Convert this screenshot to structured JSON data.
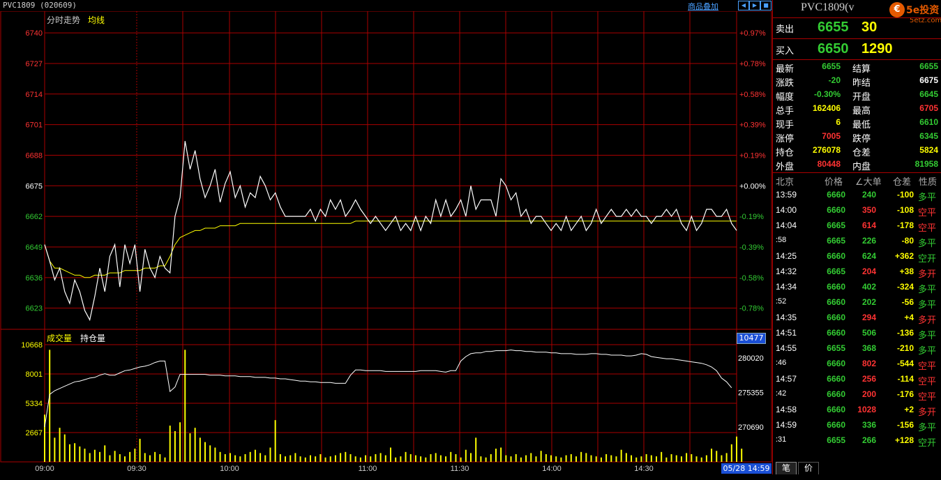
{
  "header": {
    "symbol": "PVC1809 (020609)",
    "overlay_link": "商品叠加",
    "toolbar_icons": [
      "prev-icon",
      "next-icon",
      "zoom-icon",
      "maximize-icon"
    ]
  },
  "intraday": {
    "title": "分时走势",
    "avg_label": "均线",
    "price_ticks": [
      "6740",
      "6727",
      "6714",
      "6701",
      "6688",
      "6675",
      "6662",
      "6649",
      "6636",
      "6623"
    ],
    "pct_ticks": [
      "+0.97%",
      "+0.78%",
      "+0.58%",
      "+0.39%",
      "+0.19%",
      "+0.00%",
      "-0.19%",
      "-0.39%",
      "-0.58%",
      "-0.78%"
    ]
  },
  "volume": {
    "title": "成交量",
    "oi_label": "持仓量",
    "left_ticks": [
      "10668",
      "8001",
      "5334",
      "2667"
    ],
    "right_ticks": [
      "280020",
      "275355",
      "270690"
    ],
    "highlight": "10477"
  },
  "time_axis": [
    "09:00",
    "09:30",
    "10:00",
    "11:00",
    "11:30",
    "14:00",
    "14:30"
  ],
  "date_box": "05/28 14:59",
  "chart_data": {
    "type": "line",
    "title": "分时走势",
    "series": [
      {
        "name": "分时走势",
        "values": [
          6650,
          6643,
          6635,
          6640,
          6630,
          6625,
          6635,
          6630,
          6622,
          6618,
          6628,
          6640,
          6630,
          6645,
          6650,
          6632,
          6650,
          6642,
          6650,
          6630,
          6648,
          6640,
          6636,
          6645,
          6640,
          6638,
          6662,
          6670,
          6694,
          6682,
          6690,
          6678,
          6670,
          6675,
          6682,
          6668,
          6676,
          6681,
          6670,
          6675,
          6666,
          6672,
          6670,
          6679,
          6675,
          6669,
          6672,
          6666,
          6662,
          6662,
          6662,
          6662,
          6662,
          6665,
          6660,
          6665,
          6662,
          6669,
          6665,
          6669,
          6662,
          6665,
          6669,
          6665,
          6662,
          6659,
          6662,
          6659,
          6656,
          6659,
          6662,
          6656,
          6659,
          6656,
          6662,
          6656,
          6662,
          6659,
          6669,
          6662,
          6669,
          6662,
          6665,
          6669,
          6662,
          6675,
          6665,
          6669,
          6669,
          6669,
          6662,
          6678,
          6675,
          6669,
          6672,
          6662,
          6665,
          6659,
          6662,
          6662,
          6659,
          6656,
          6659,
          6656,
          6662,
          6656,
          6659,
          6662,
          6656,
          6659,
          6665,
          6659,
          6662,
          6665,
          6662,
          6662,
          6665,
          6662,
          6665,
          6662,
          6662,
          6659,
          6662,
          6662,
          6665,
          6662,
          6665,
          6659,
          6656,
          6662,
          6656,
          6659,
          6665,
          6665,
          6662,
          6662,
          6665,
          6659,
          6656
        ]
      },
      {
        "name": "均线",
        "values": [
          6650,
          6643,
          6640,
          6640,
          6639,
          6638,
          6637,
          6637,
          6636,
          6636,
          6637,
          6637,
          6637,
          6638,
          6638,
          6638,
          6639,
          6639,
          6639,
          6639,
          6640,
          6640,
          6640,
          6641,
          6641,
          6645,
          6650,
          6653,
          6654,
          6655,
          6656,
          6656,
          6657,
          6657,
          6657,
          6658,
          6658,
          6658,
          6658,
          6659,
          6659,
          6659,
          6659,
          6659,
          6659,
          6659,
          6659,
          6659,
          6659,
          6659,
          6659,
          6659,
          6659,
          6659,
          6659,
          6659,
          6659,
          6659,
          6659,
          6659,
          6659,
          6659,
          6660,
          6660,
          6660,
          6660,
          6660,
          6660,
          6660,
          6660,
          6660,
          6660,
          6660,
          6660,
          6660,
          6660,
          6660,
          6660,
          6660,
          6660,
          6660,
          6660,
          6660,
          6660,
          6660,
          6660,
          6660,
          6660,
          6660,
          6660,
          6660,
          6660,
          6660,
          6660,
          6660,
          6660,
          6660,
          6660,
          6660,
          6660,
          6660,
          6660,
          6660,
          6660,
          6660,
          6660,
          6660,
          6660,
          6660,
          6660,
          6660,
          6660,
          6660,
          6660,
          6660,
          6660,
          6660,
          6660,
          6660,
          6660,
          6660,
          6660,
          6660,
          6660,
          6660,
          6660,
          6660,
          6660,
          6660,
          6660,
          6660,
          6660,
          6660,
          6660,
          6660,
          6660,
          6660,
          6660,
          6660
        ]
      },
      {
        "name": "成交量",
        "values": [
          4300,
          10200,
          2200,
          3100,
          2500,
          1600,
          1700,
          1400,
          1200,
          800,
          1100,
          900,
          1500,
          600,
          1000,
          700,
          500,
          900,
          1200,
          2100,
          800,
          600,
          900,
          700,
          400,
          3300,
          2800,
          3600,
          10200,
          2600,
          3100,
          2200,
          1800,
          1500,
          1300,
          900,
          700,
          800,
          600,
          500,
          700,
          900,
          1100,
          800,
          600,
          1300,
          3800,
          700,
          500,
          600,
          800,
          500,
          400,
          600,
          500,
          700,
          400,
          500,
          600,
          800,
          900,
          700,
          500,
          400,
          600,
          500,
          700,
          800,
          600,
          1300,
          400,
          500,
          900,
          700,
          600,
          500,
          400,
          700,
          800,
          600,
          500,
          900,
          700,
          400,
          1100,
          800,
          2200,
          500,
          400,
          700,
          1200,
          1300,
          600,
          500,
          700,
          400,
          600,
          800,
          500,
          1000,
          700,
          600,
          500,
          400,
          600,
          700,
          500,
          900,
          800,
          600,
          500,
          400,
          700,
          600,
          500,
          1100,
          800,
          600,
          400,
          500,
          700,
          600,
          500,
          900,
          400,
          700,
          600,
          500,
          800,
          700,
          500,
          400,
          600,
          1200,
          1000,
          600,
          800,
          1600,
          2300,
          1200
        ]
      },
      {
        "name": "持仓量",
        "values": [
          270700,
          275100,
          275600,
          275900,
          276200,
          276500,
          276800,
          276900,
          277100,
          277300,
          277400,
          277700,
          277900,
          277700,
          277700,
          278000,
          278300,
          278400,
          278600,
          278800,
          278900,
          279100,
          279400,
          279600,
          279600,
          275500,
          276100,
          277800,
          277800,
          277800,
          277800,
          277800,
          277800,
          277700,
          277700,
          277700,
          277600,
          277600,
          277600,
          277500,
          277500,
          277500,
          277400,
          277400,
          277400,
          277300,
          277300,
          277200,
          277200,
          277100,
          277000,
          276900,
          276900,
          276800,
          276800,
          276700,
          276700,
          276700,
          276600,
          276600,
          276600,
          277700,
          278400,
          278400,
          278300,
          278300,
          278300,
          278300,
          278200,
          278200,
          278200,
          278200,
          278200,
          278200,
          278200,
          278300,
          278300,
          278300,
          278300,
          278200,
          278100,
          278300,
          278300,
          279600,
          280200,
          280600,
          280700,
          280700,
          280900,
          280900,
          281000,
          281000,
          281000,
          281100,
          281000,
          281000,
          280900,
          280900,
          280800,
          280800,
          280800,
          280700,
          280700,
          280600,
          280600,
          280600,
          280500,
          280500,
          280500,
          280600,
          280600,
          280500,
          280500,
          280400,
          280400,
          280400,
          280300,
          280300,
          280400,
          280600,
          280500,
          280200,
          280100,
          280000,
          279900,
          279900,
          279800,
          279700,
          279600,
          279500,
          279400,
          279300,
          279100,
          278800,
          278300,
          277300,
          276800,
          276000
        ]
      }
    ],
    "price_ylim": [
      6614,
      6743
    ],
    "volume_ylim": [
      0,
      10668
    ],
    "oi_ylim": [
      266000,
      282000
    ]
  },
  "side": {
    "title": "PVC1809(v",
    "logo_text": "5e投资",
    "logo_url": "5etz.com",
    "ask_label": "卖出",
    "ask_price": "6655",
    "ask_vol": "30",
    "bid_label": "买入",
    "bid_price": "6650",
    "bid_vol": "1290",
    "stats": [
      {
        "l1": "最新",
        "v1": "6655",
        "c1": "#3c3",
        "l2": "结算",
        "v2": "6655",
        "c2": "#3c3"
      },
      {
        "l1": "涨跌",
        "v1": "-20",
        "c1": "#3c3",
        "l2": "昨结",
        "v2": "6675",
        "c2": "#fff"
      },
      {
        "l1": "幅度",
        "v1": "-0.30%",
        "c1": "#3c3",
        "l2": "开盘",
        "v2": "6645",
        "c2": "#3c3"
      },
      {
        "l1": "总手",
        "v1": "162406",
        "c1": "#ff0",
        "l2": "最高",
        "v2": "6705",
        "c2": "#f33"
      },
      {
        "l1": "现手",
        "v1": "6",
        "c1": "#ff0",
        "l2": "最低",
        "v2": "6610",
        "c2": "#3c3"
      },
      {
        "l1": "涨停",
        "v1": "7005",
        "c1": "#f33",
        "l2": "跌停",
        "v2": "6345",
        "c2": "#3c3"
      },
      {
        "l1": "持仓",
        "v1": "276078",
        "c1": "#ff0",
        "l2": "仓差",
        "v2": "5824",
        "c2": "#ff0"
      },
      {
        "l1": "外盘",
        "v1": "80448",
        "c1": "#f33",
        "l2": "内盘",
        "v2": "81958",
        "c2": "#3c3"
      }
    ],
    "tick_headers": [
      "北京",
      "价格",
      "∠大单",
      "仓差",
      "性质"
    ],
    "ticks": [
      {
        "t": "13:59",
        "p": "6660",
        "v": "240",
        "d": "-100",
        "n": "多平",
        "nc": "#3c3"
      },
      {
        "t": "14:00",
        "p": "6660",
        "v": "350",
        "d": "-108",
        "n": "空平",
        "nc": "#f33"
      },
      {
        "t": "14:04",
        "p": "6665",
        "v": "614",
        "d": "-178",
        "n": "空平",
        "nc": "#f33"
      },
      {
        "t": ":58",
        "p": "6665",
        "v": "226",
        "d": "-80",
        "n": "多平",
        "nc": "#3c3"
      },
      {
        "t": "14:25",
        "p": "6660",
        "v": "624",
        "d": "+362",
        "n": "空开",
        "nc": "#3c3"
      },
      {
        "t": "14:32",
        "p": "6665",
        "v": "204",
        "d": "+38",
        "n": "多开",
        "nc": "#f33"
      },
      {
        "t": "14:34",
        "p": "6660",
        "v": "402",
        "d": "-324",
        "n": "多平",
        "nc": "#3c3"
      },
      {
        "t": ":52",
        "p": "6660",
        "v": "202",
        "d": "-56",
        "n": "多平",
        "nc": "#3c3"
      },
      {
        "t": "14:35",
        "p": "6660",
        "v": "294",
        "d": "+4",
        "n": "多开",
        "nc": "#f33"
      },
      {
        "t": "14:51",
        "p": "6660",
        "v": "506",
        "d": "-136",
        "n": "多平",
        "nc": "#3c3"
      },
      {
        "t": "14:55",
        "p": "6655",
        "v": "368",
        "d": "-210",
        "n": "多平",
        "nc": "#3c3"
      },
      {
        "t": ":46",
        "p": "6660",
        "v": "802",
        "d": "-544",
        "n": "空平",
        "nc": "#f33"
      },
      {
        "t": "14:57",
        "p": "6660",
        "v": "256",
        "d": "-114",
        "n": "空平",
        "nc": "#f33"
      },
      {
        "t": ":42",
        "p": "6660",
        "v": "200",
        "d": "-176",
        "n": "空平",
        "nc": "#f33"
      },
      {
        "t": "14:58",
        "p": "6660",
        "v": "1028",
        "d": "+2",
        "n": "多开",
        "nc": "#f33"
      },
      {
        "t": "14:59",
        "p": "6660",
        "v": "336",
        "d": "-156",
        "n": "多平",
        "nc": "#3c3"
      },
      {
        "t": ":31",
        "p": "6655",
        "v": "266",
        "d": "+128",
        "n": "空开",
        "nc": "#3c3"
      }
    ],
    "tabs": [
      "笔",
      "价"
    ]
  }
}
